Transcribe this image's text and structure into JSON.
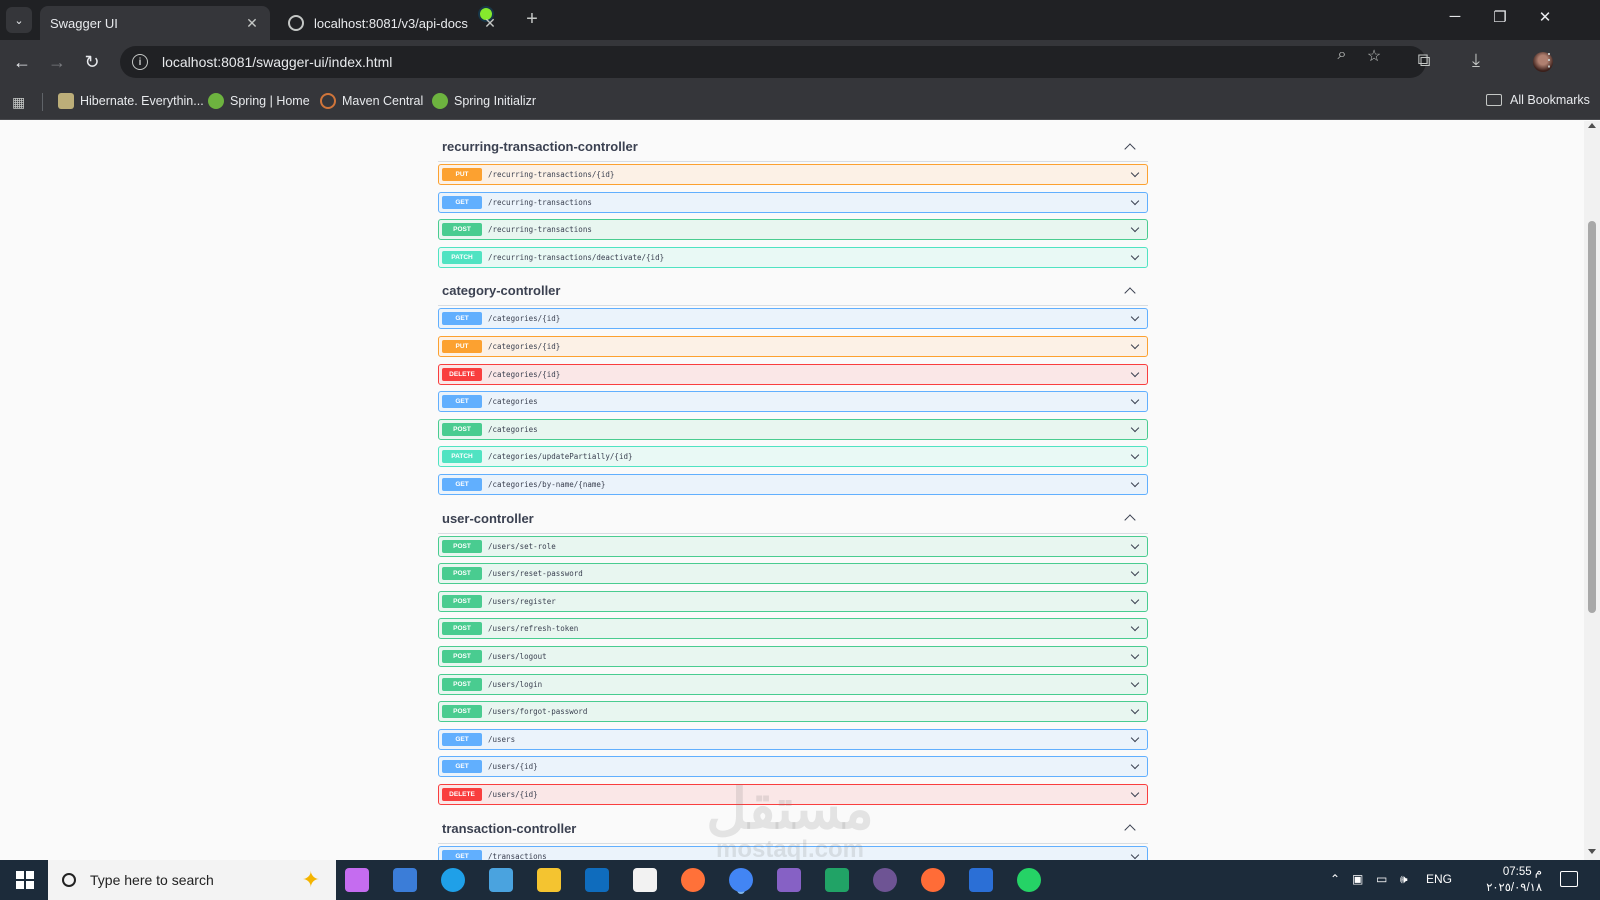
{
  "browser": {
    "tabs": [
      {
        "title": "Swagger UI",
        "active": true
      },
      {
        "title": "localhost:8081/v3/api-docs",
        "active": false
      }
    ],
    "url": "localhost:8081/swagger-ui/index.html",
    "bookmarks": [
      {
        "label": "Hibernate. Everythin..."
      },
      {
        "label": "Spring | Home"
      },
      {
        "label": "Maven Central"
      },
      {
        "label": "Spring Initializr"
      }
    ],
    "all_bookmarks_label": "All Bookmarks"
  },
  "sections": [
    {
      "title": "recurring-transaction-controller",
      "operations": [
        {
          "method": "PUT",
          "path": "/recurring-transactions/{id}"
        },
        {
          "method": "GET",
          "path": "/recurring-transactions"
        },
        {
          "method": "POST",
          "path": "/recurring-transactions"
        },
        {
          "method": "PATCH",
          "path": "/recurring-transactions/deactivate/{id}"
        }
      ]
    },
    {
      "title": "category-controller",
      "operations": [
        {
          "method": "GET",
          "path": "/categories/{id}"
        },
        {
          "method": "PUT",
          "path": "/categories/{id}"
        },
        {
          "method": "DELETE",
          "path": "/categories/{id}"
        },
        {
          "method": "GET",
          "path": "/categories"
        },
        {
          "method": "POST",
          "path": "/categories"
        },
        {
          "method": "PATCH",
          "path": "/categories/updatePartially/{id}"
        },
        {
          "method": "GET",
          "path": "/categories/by-name/{name}"
        }
      ]
    },
    {
      "title": "user-controller",
      "operations": [
        {
          "method": "POST",
          "path": "/users/set-role"
        },
        {
          "method": "POST",
          "path": "/users/reset-password"
        },
        {
          "method": "POST",
          "path": "/users/register"
        },
        {
          "method": "POST",
          "path": "/users/refresh-token"
        },
        {
          "method": "POST",
          "path": "/users/logout"
        },
        {
          "method": "POST",
          "path": "/users/login"
        },
        {
          "method": "POST",
          "path": "/users/forgot-password"
        },
        {
          "method": "GET",
          "path": "/users"
        },
        {
          "method": "GET",
          "path": "/users/{id}"
        },
        {
          "method": "DELETE",
          "path": "/users/{id}"
        }
      ]
    },
    {
      "title": "transaction-controller",
      "operations": [
        {
          "method": "GET",
          "path": "/transactions"
        }
      ]
    }
  ],
  "method_colors": {
    "GET": "#61affe",
    "POST": "#49cc90",
    "PUT": "#fca130",
    "PATCH": "#50e3c2",
    "DELETE": "#f93e3e"
  },
  "watermark": {
    "main": "مستقل",
    "sub": "mostaql.com"
  },
  "taskbar": {
    "search_placeholder": "Type here to search",
    "language": "ENG",
    "time": "07:55 م",
    "date": "٢٠٢٥/٠٩/١٨",
    "apps": [
      "copilot-icon",
      "store-icon",
      "edge-icon",
      "photos-icon",
      "explorer-icon",
      "outlook-icon",
      "notepad-icon",
      "firefox-icon",
      "chrome-icon",
      "visual-studio-icon",
      "excel-icon",
      "github-icon",
      "postman-icon",
      "intellij-icon",
      "whatsapp-icon"
    ]
  }
}
